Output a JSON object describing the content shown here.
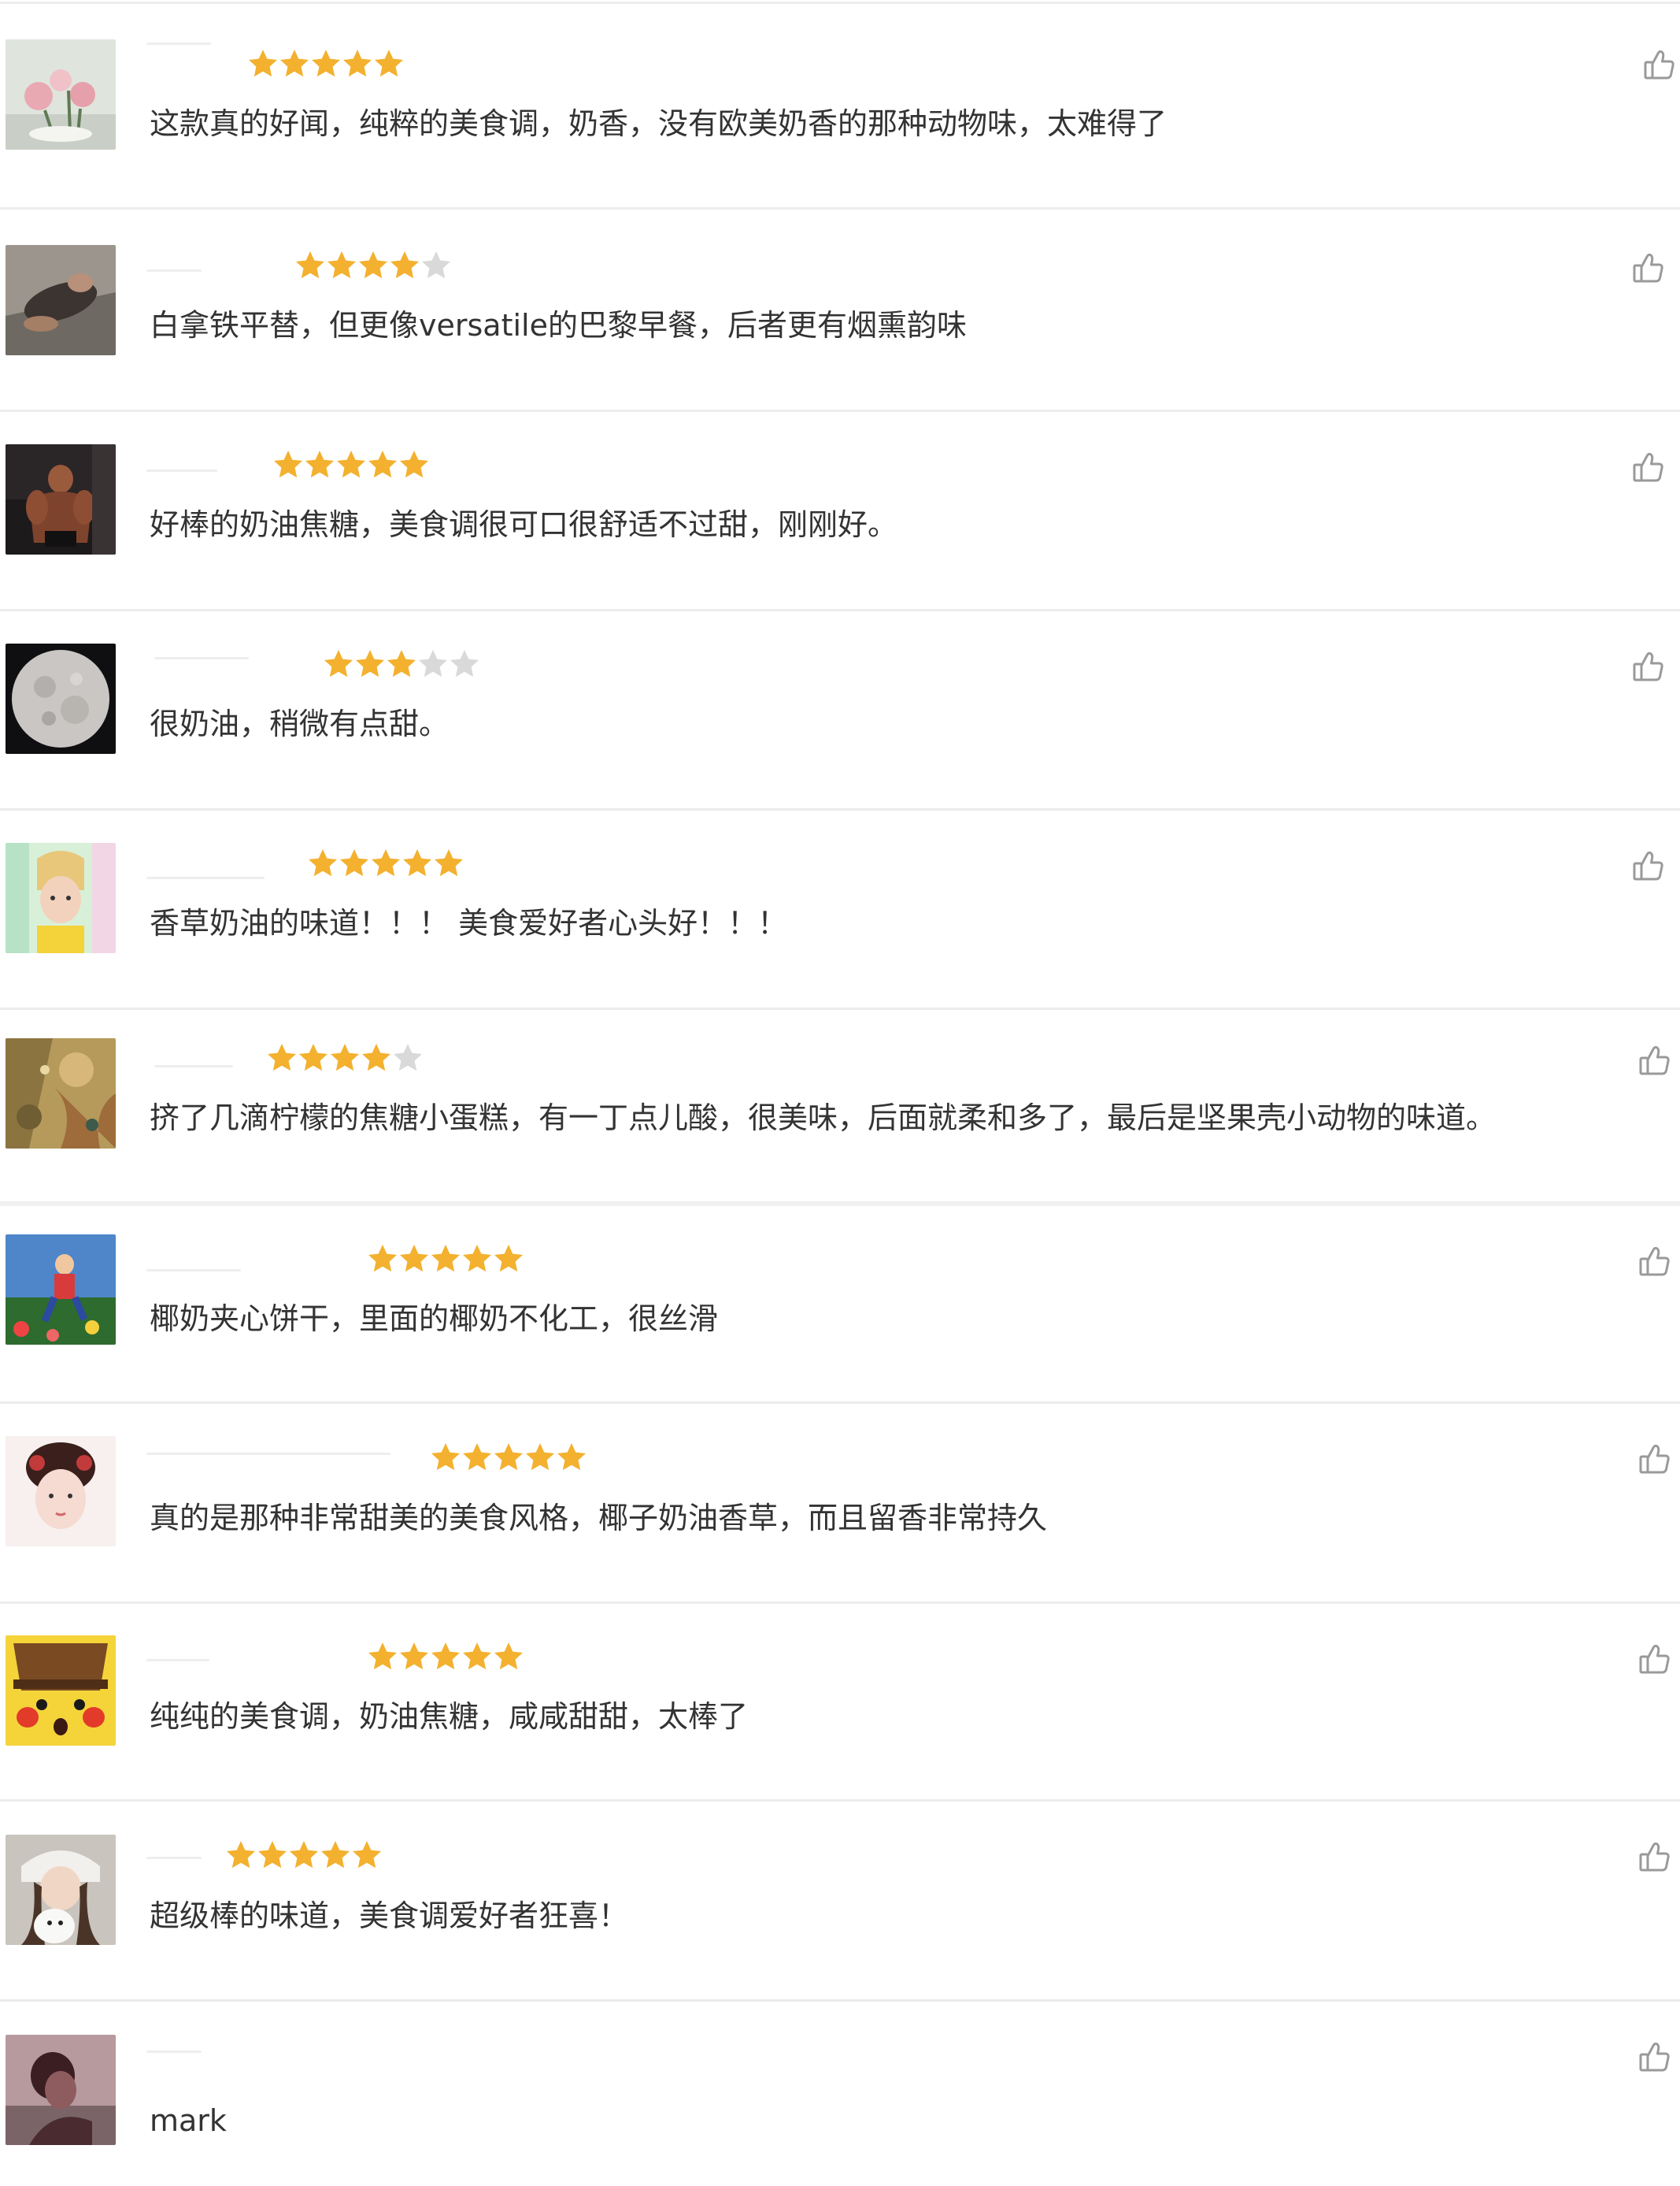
{
  "colors": {
    "star_filled": "#f3b12f",
    "star_empty": "#d9d9d9",
    "comment_text": "#333333",
    "divider": "#ececec",
    "like_icon": "#9a9a9a"
  },
  "reviews": [
    {
      "rating": 5,
      "comment": "这款真的好闻，纯粹的美食调，奶香，没有欧美奶香的那种动物味，太难得了",
      "like_icon": "thumbs-up-icon"
    },
    {
      "rating": 4,
      "comment": "白拿铁平替，但更像versatile的巴黎早餐，后者更有烟熏韵味",
      "like_icon": "thumbs-up-icon"
    },
    {
      "rating": 5,
      "comment": "好棒的奶油焦糖，美食调很可口很舒适不过甜，刚刚好。",
      "like_icon": "thumbs-up-icon"
    },
    {
      "rating": 3,
      "comment": "很奶油，稍微有点甜。",
      "like_icon": "thumbs-up-icon"
    },
    {
      "rating": 5,
      "comment": "香草奶油的味道！！！ 美食爱好者心头好！！！",
      "like_icon": "thumbs-up-icon"
    },
    {
      "rating": 4,
      "comment": "挤了几滴柠檬的焦糖小蛋糕，有一丁点儿酸，很美味，后面就柔和多了，最后是坚果壳小动物的味道。",
      "like_icon": "thumbs-up-icon"
    },
    {
      "rating": 5,
      "comment": "椰奶夹心饼干，里面的椰奶不化工，很丝滑",
      "like_icon": "thumbs-up-icon"
    },
    {
      "rating": 5,
      "comment": "真的是那种非常甜美的美食风格，椰子奶油香草，而且留香非常持久",
      "like_icon": "thumbs-up-icon"
    },
    {
      "rating": 5,
      "comment": "纯纯的美食调，奶油焦糖，咸咸甜甜，太棒了",
      "like_icon": "thumbs-up-icon"
    },
    {
      "rating": 5,
      "comment": "超级棒的味道，美食调爱好者狂喜！",
      "like_icon": "thumbs-up-icon"
    },
    {
      "rating": null,
      "comment": "mark",
      "like_icon": "thumbs-up-icon"
    }
  ]
}
